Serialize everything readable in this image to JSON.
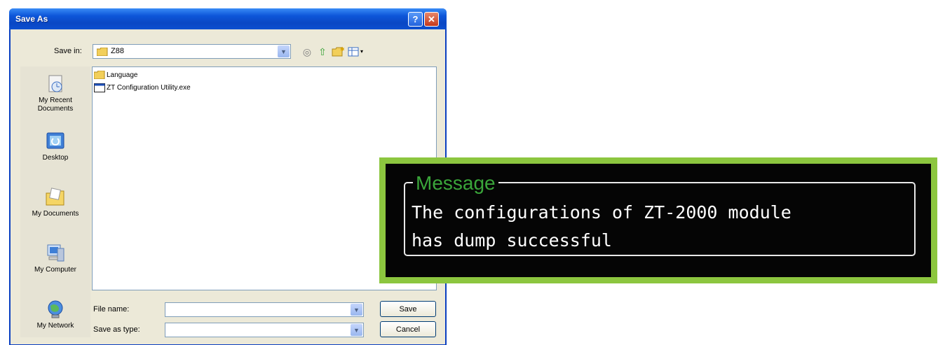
{
  "dialog": {
    "title": "Save As",
    "help_glyph": "?",
    "close_glyph": "✕",
    "save_in_label": "Save in:",
    "save_in_value": "Z88",
    "places": [
      {
        "label": "My Recent Documents",
        "icon": "recent-documents-icon"
      },
      {
        "label": "Desktop",
        "icon": "desktop-icon"
      },
      {
        "label": "My Documents",
        "icon": "my-documents-icon"
      },
      {
        "label": "My Computer",
        "icon": "my-computer-icon"
      },
      {
        "label": "My Network",
        "icon": "my-network-icon"
      }
    ],
    "files": [
      {
        "name": "Language",
        "icon": "folder-icon"
      },
      {
        "name": "ZT Configuration Utility.exe",
        "icon": "application-icon"
      }
    ],
    "file_name_label": "File name:",
    "file_name_value": "",
    "save_as_type_label": "Save as type:",
    "save_as_type_value": "",
    "save_button": "Save",
    "cancel_button": "Cancel"
  },
  "message": {
    "title": "Message",
    "text": "The configurations of ZT-2000 module\nhas dump successful"
  },
  "colors": {
    "titlebar": "#0a47c4",
    "frame_accent": "#8cc63f",
    "message_title": "#3aa53a"
  }
}
